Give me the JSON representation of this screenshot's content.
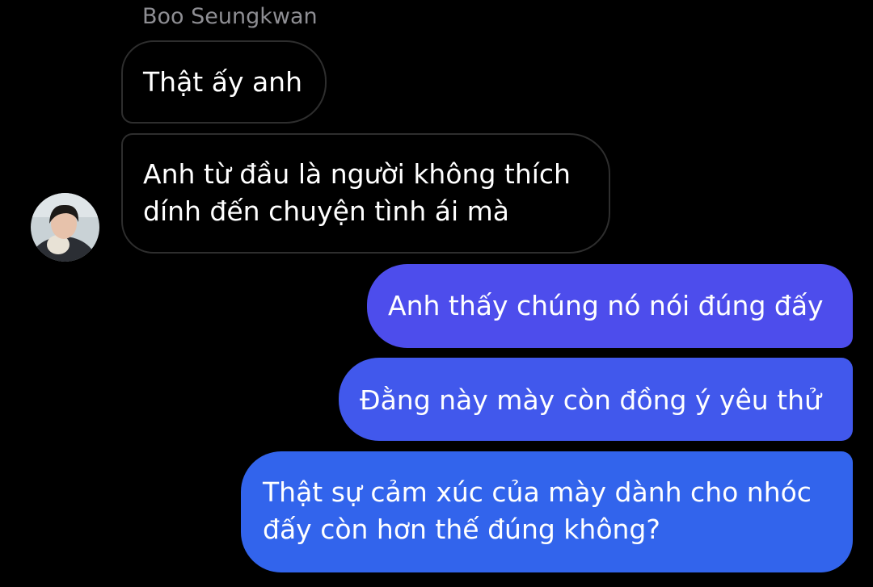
{
  "conversation": {
    "sender_name": "Boo Seungkwan",
    "colors": {
      "background": "#000000",
      "incoming_border": "#2e2e2e",
      "outgoing_top": "#4f4bec",
      "outgoing_bottom": "#2e63ec"
    },
    "avatar": {
      "icon": "user-avatar-photo"
    },
    "messages": [
      {
        "direction": "incoming",
        "lines": [
          "Thật ấy anh"
        ]
      },
      {
        "direction": "incoming",
        "lines": [
          "Anh từ đầu là người không thích",
          "dính đến chuyện tình ái mà"
        ]
      },
      {
        "direction": "outgoing",
        "lines": [
          "Anh thấy chúng nó nói đúng đấy"
        ]
      },
      {
        "direction": "outgoing",
        "lines": [
          "Đằng này mày còn đồng ý yêu thử"
        ]
      },
      {
        "direction": "outgoing",
        "lines": [
          "Thật sự cảm xúc của mày dành cho nhóc",
          "đấy còn hơn thế đúng không?"
        ]
      }
    ]
  }
}
